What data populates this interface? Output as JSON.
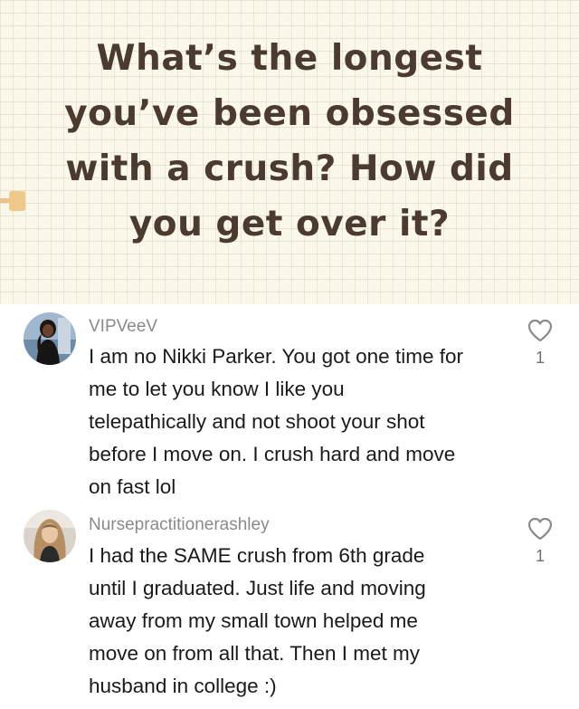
{
  "post": {
    "question_lines": [
      "What’s the longest",
      "you’ve been obsessed",
      "with a crush? How did",
      "you get over it?"
    ]
  },
  "comments": [
    {
      "username": "VIPVeeV",
      "lines": [
        "I am no Nikki Parker. You got one time for",
        "me to let you know I like you",
        "telepathically and not shoot your shot",
        "before I move on. I crush hard and move",
        "on fast lol"
      ],
      "likes": "1",
      "like_icon": "heart-outline-icon",
      "avatar_icon": "user-avatar"
    },
    {
      "username": "Nursepractitionerashley",
      "lines": [
        "I had the SAME crush from 6th grade",
        "until I graduated. Just life and moving",
        "away from my small town helped me",
        "move on from all that. Then I met my",
        "husband in college :)"
      ],
      "likes": "1",
      "like_icon": "heart-outline-icon",
      "avatar_icon": "user-avatar"
    }
  ],
  "colors": {
    "header_bg": "#fbf7ea",
    "question_text": "#4a3b2e",
    "username_text": "#8a8a8a",
    "body_text": "#1a1a1a",
    "icon_gray": "#8a8a8a",
    "tab_marker": "#efc989"
  }
}
